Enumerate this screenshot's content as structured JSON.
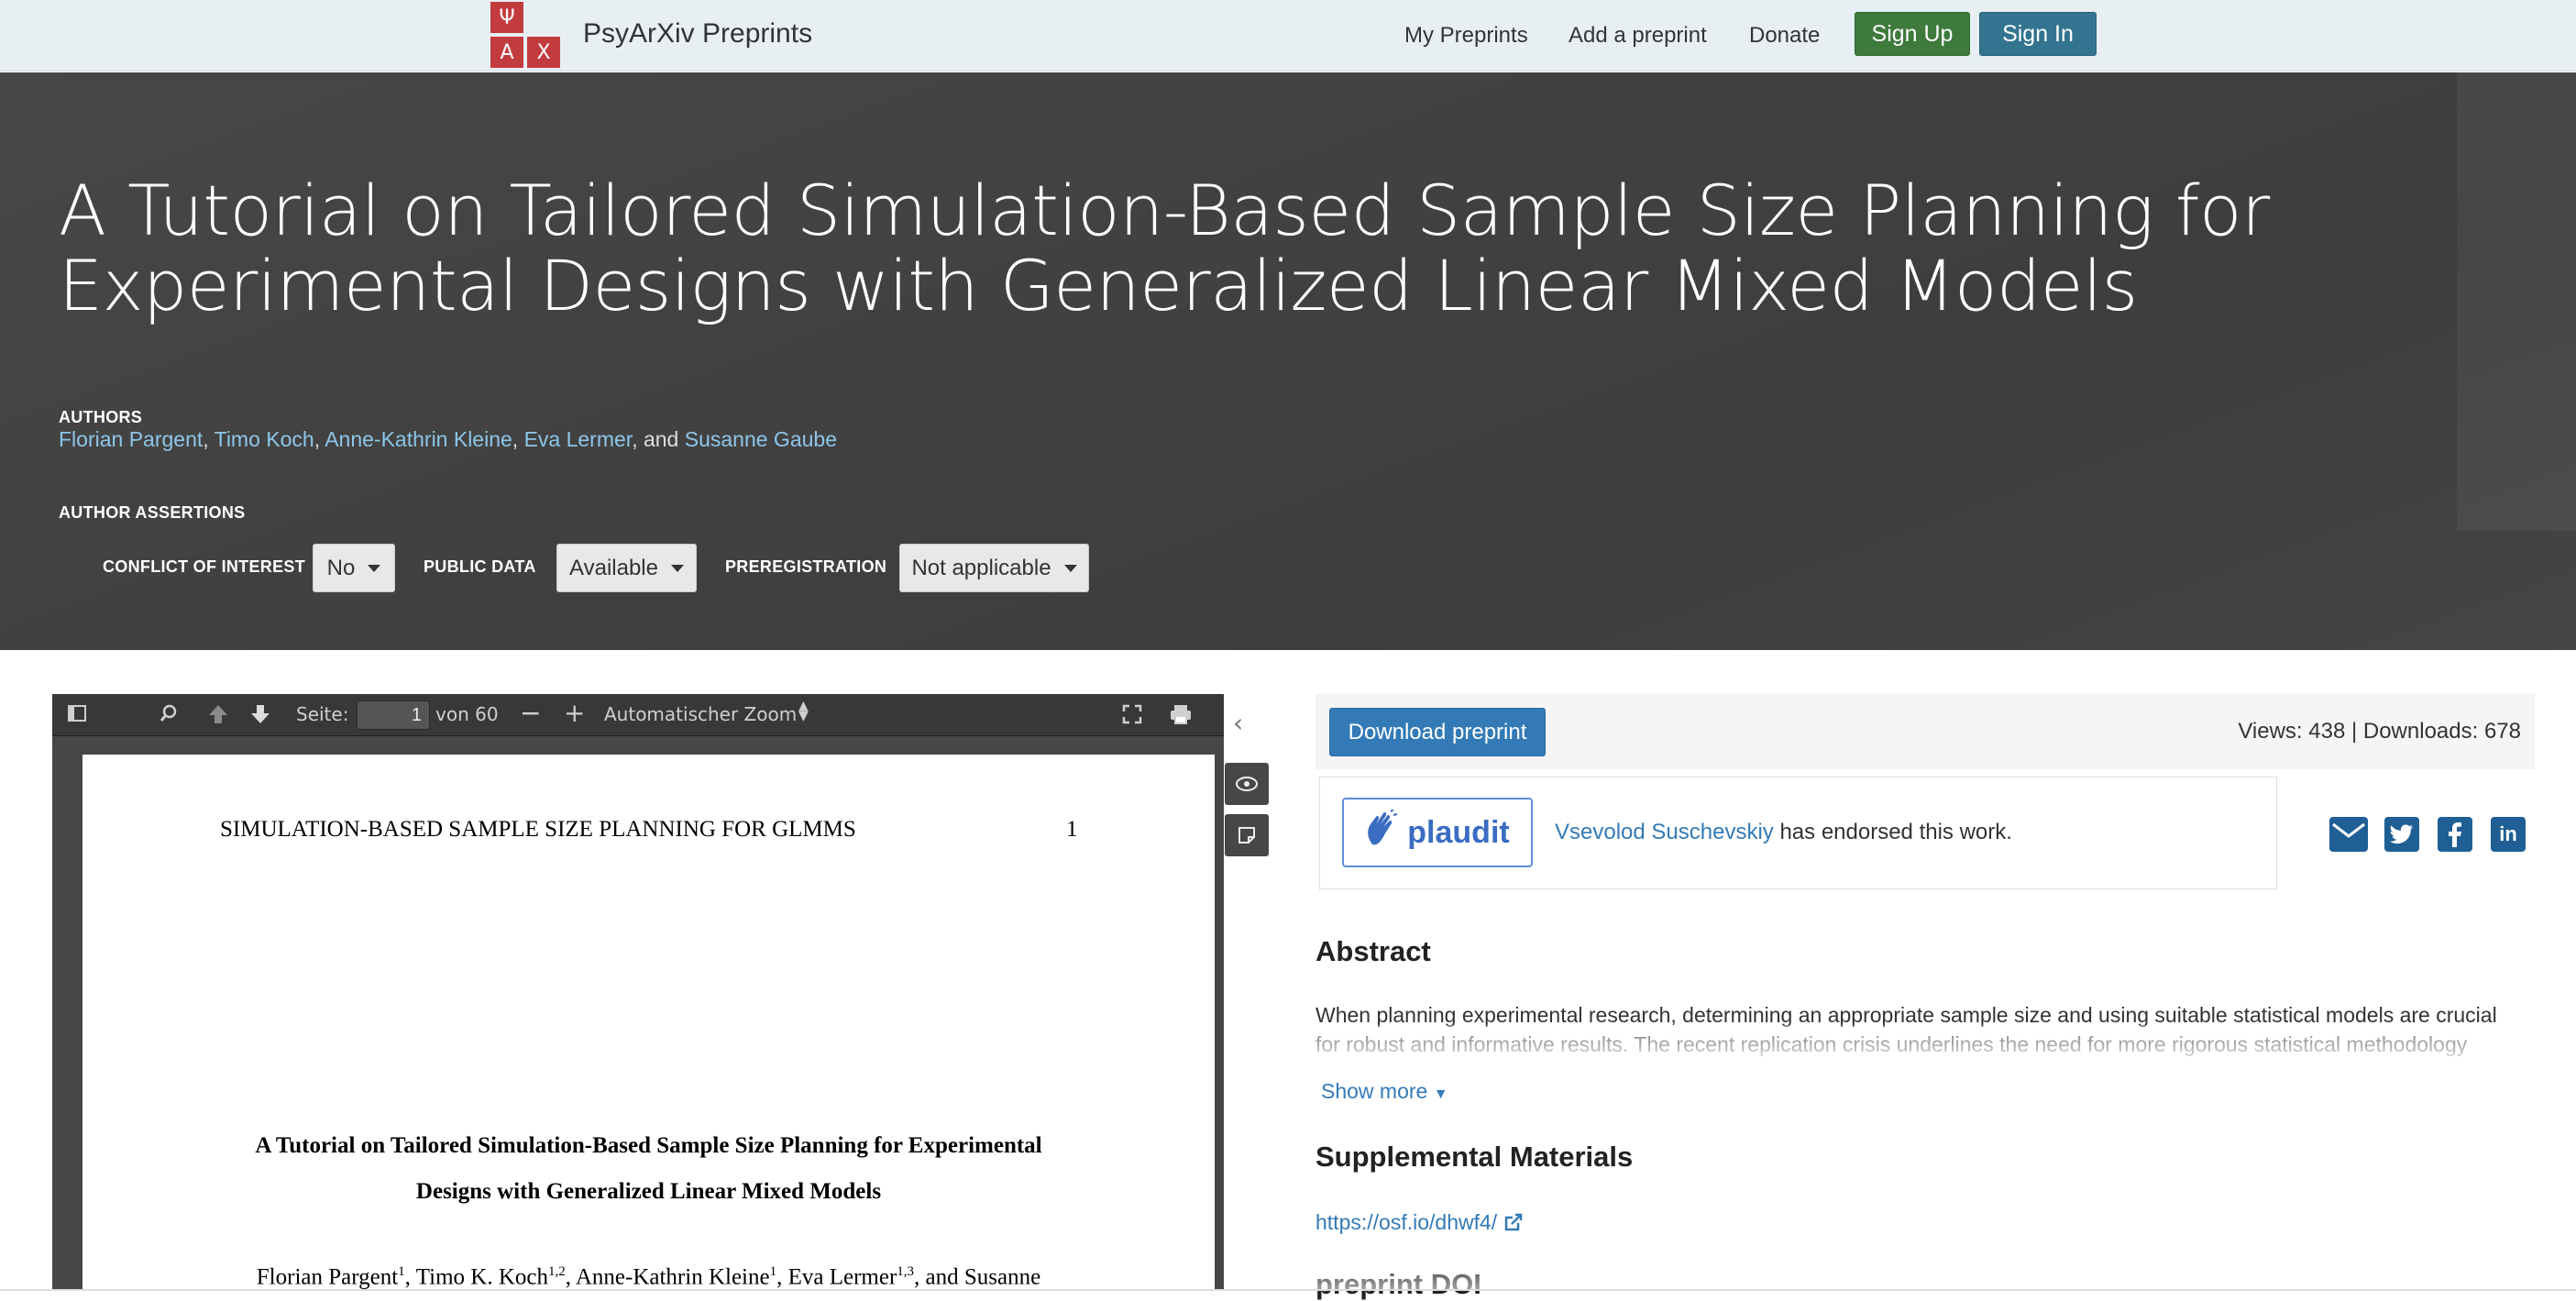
{
  "nav": {
    "logo_letters": [
      "Ψ",
      "A",
      "X"
    ],
    "brand": "PsyArXiv Preprints",
    "links": [
      "My Preprints",
      "Add a preprint",
      "Donate"
    ],
    "sign_up": "Sign Up",
    "sign_in": "Sign In"
  },
  "hero": {
    "title": "A Tutorial on Tailored Simulation-Based Sample Size Planning for Experimental Designs with Generalized Linear Mixed Models",
    "authors_label": "AUTHORS",
    "authors": [
      "Florian Pargent",
      "Timo Koch",
      "Anne-Kathrin Kleine",
      "Eva Lermer",
      "Susanne Gaube"
    ],
    "authors_and": "and",
    "assertions_label": "AUTHOR ASSERTIONS",
    "coi_label": "CONFLICT OF INTEREST",
    "coi_value": "No",
    "public_data_label": "PUBLIC DATA",
    "public_data_value": "Available",
    "prereg_label": "PREREGISTRATION",
    "prereg_value": "Not applicable"
  },
  "viewer": {
    "page_label": "Seite:",
    "page_current": "1",
    "page_total": "von 60",
    "zoom": "Automatischer Zoom",
    "icons": [
      "sidebar-toggle-icon",
      "search-icon",
      "prev-page-icon",
      "next-page-icon",
      "zoom-out-icon",
      "zoom-in-icon",
      "fullscreen-icon",
      "print-icon"
    ],
    "page": {
      "running_head": "SIMULATION-BASED SAMPLE SIZE PLANNING FOR GLMMS",
      "page_number": "1",
      "title_line1": "A Tutorial on Tailored Simulation-Based Sample Size Planning for Experimental",
      "title_line2": "Designs with Generalized Linear Mixed Models",
      "authors": [
        {
          "name": "Florian Pargent",
          "sup": "1"
        },
        {
          "name": "Timo K. Koch",
          "sup": "1,2"
        },
        {
          "name": "Anne-Kathrin Kleine",
          "sup": "1"
        },
        {
          "name": "Eva Lermer",
          "sup": "1,3"
        }
      ],
      "authors_tail": ", and Susanne"
    }
  },
  "details": {
    "download_label": "Download preprint",
    "stats": "Views: 438 | Downloads: 678",
    "plaudit_word": "plaudit",
    "endorser": "Vsevolod Suschevskiy",
    "endorse_text": "has endorsed this work.",
    "share_icons": [
      "email-icon",
      "twitter-icon",
      "facebook-icon",
      "linkedin-icon"
    ],
    "abstract_heading": "Abstract",
    "abstract_text": "When planning experimental research, determining an appropriate sample size and using suitable statistical models are crucial for robust and informative results. The recent replication crisis underlines the need for more rigorous statistical methodology and adequate sample size planning. Generalized linear mixed models (GLMMs) offer a flexible statistical framework to analyze",
    "show_more": "Show more",
    "supp_heading": "Supplemental Materials",
    "supp_link": "https://osf.io/dhwf4/",
    "doi_heading": "preprint DOI"
  }
}
